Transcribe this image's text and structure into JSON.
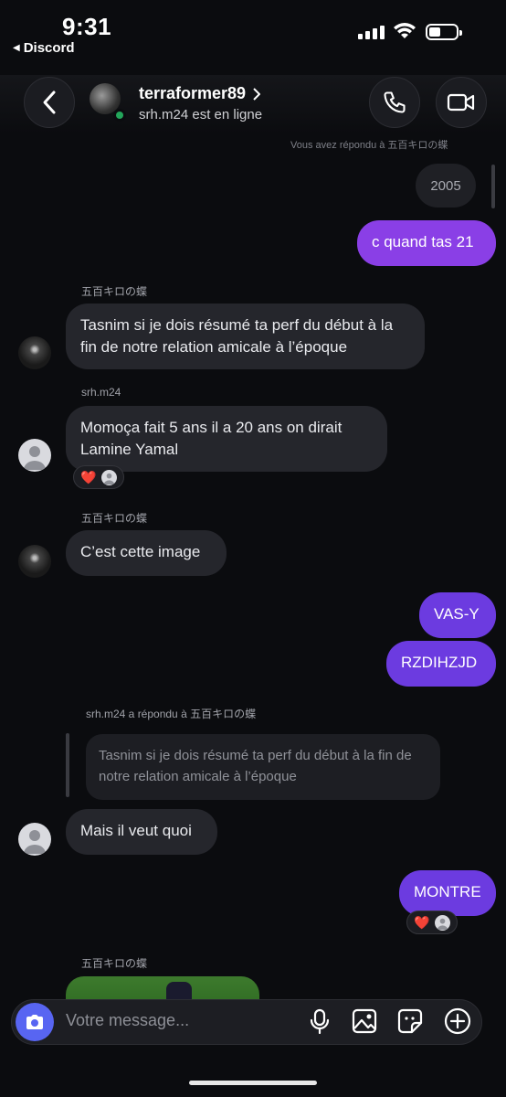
{
  "status_bar": {
    "time": "9:31",
    "back_app": "Discord"
  },
  "header": {
    "name": "terraformer89",
    "status": "srh.m24 est en ligne"
  },
  "chat": {
    "reply_top": "Vous avez répondu à 五百キロの蝶",
    "pill_2005": "2005",
    "msg_quand": "c quand tas 21",
    "sender1": "五百キロの蝶",
    "msg_tasnim": "Tasnim si je dois résumé ta perf du début à la fin de notre relation amicale à l’époque",
    "sender2": "srh.m24",
    "msg_momoca": "Momoça fait 5 ans il a 20 ans on dirait Lamine Yamal",
    "reaction_heart": "❤️",
    "sender3": "五百キロの蝶",
    "msg_image": "C’est cette image",
    "msg_vasy": "VAS-Y",
    "msg_rzd": "RZDIHZJD",
    "reply_meta": "srh.m24 a répondu à 五百キロの蝶",
    "quote_text": "Tasnim si je dois résumé ta perf du début à la fin de notre relation amicale à l’époque",
    "msg_mais": "Mais il veut quoi",
    "msg_montre": "MONTRE",
    "sender4": "五百キロの蝶"
  },
  "composer": {
    "placeholder": "Votre message..."
  },
  "colors": {
    "accent": "#5865f2",
    "outgoing": "#6c3be0",
    "online": "#23a55a"
  }
}
